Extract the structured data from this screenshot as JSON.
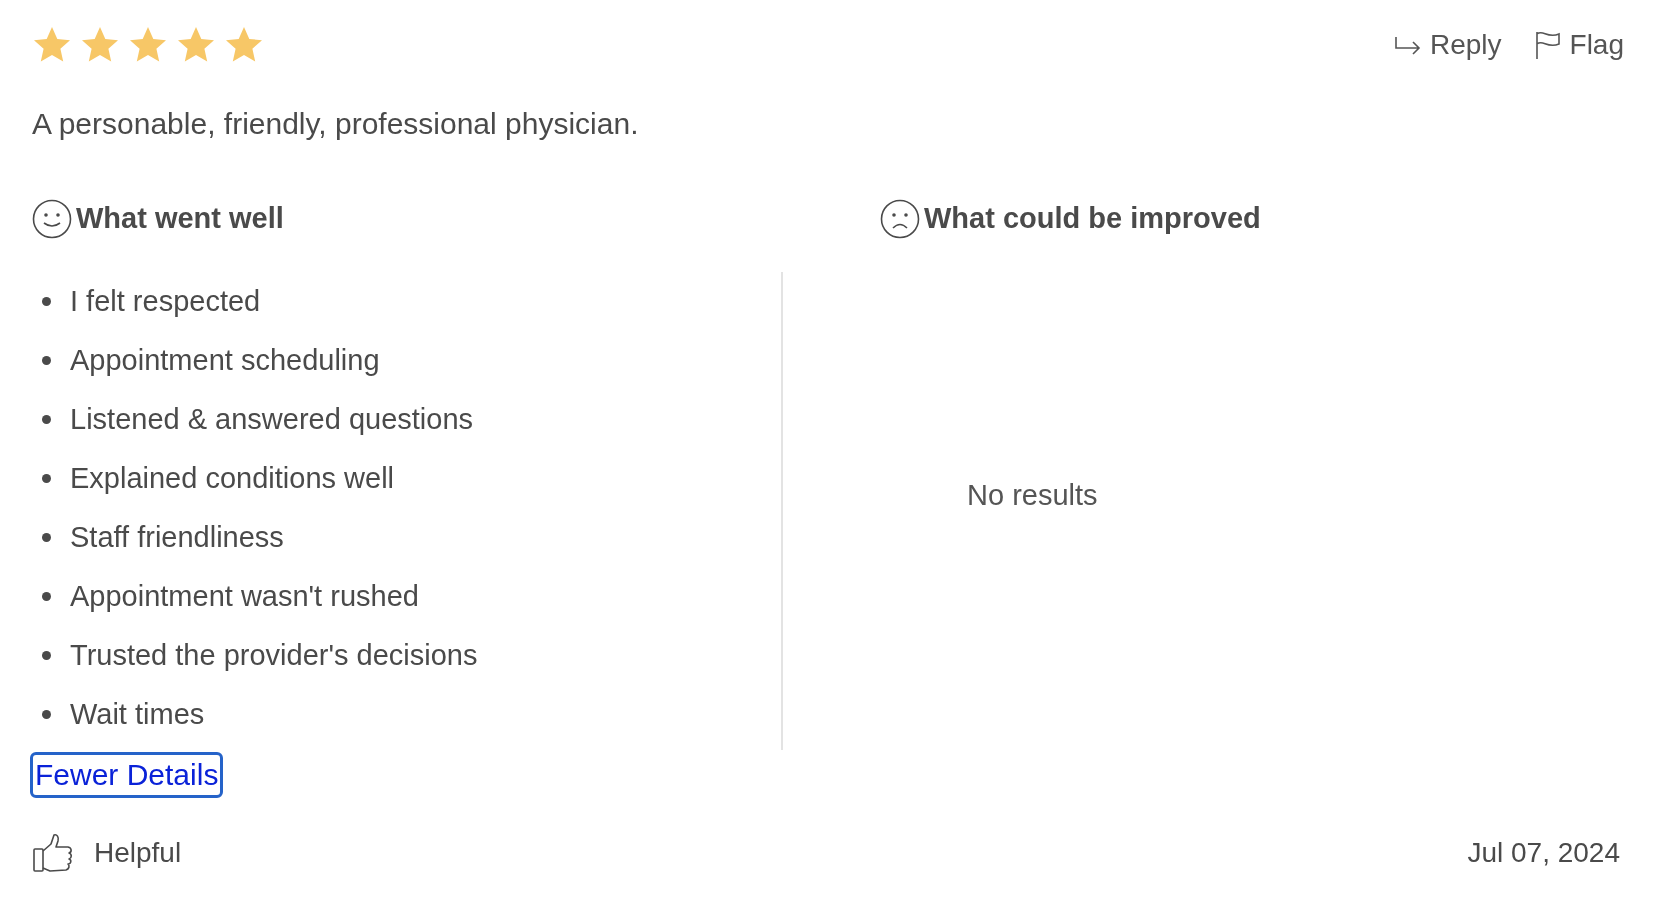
{
  "review": {
    "stars": 5,
    "actions": [
      {
        "kind": "reply",
        "label": "Reply"
      },
      {
        "kind": "flag",
        "label": "Flag"
      }
    ],
    "comment": "A personable, friendly, professional physician."
  },
  "went_well": {
    "heading": "What went well",
    "items": [
      "I felt respected",
      "Appointment scheduling",
      "Listened & answered questions",
      "Explained conditions well",
      "Staff friendliness",
      "Appointment wasn't rushed",
      "Trusted the provider's decisions",
      "Wait times"
    ]
  },
  "could_improve": {
    "heading": "What could be improved",
    "empty_message": "No results"
  },
  "details_link": {
    "label": "Fewer Details",
    "focused": true
  },
  "footer": {
    "helpful": "Helpful",
    "date": "Jul 07, 2024"
  }
}
